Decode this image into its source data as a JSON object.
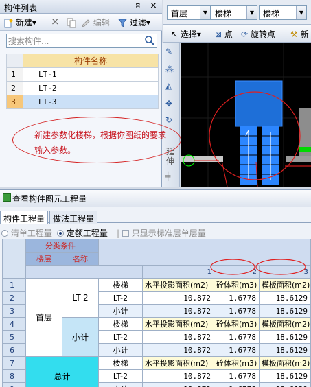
{
  "left_panel": {
    "title": "构件列表",
    "pin": "ʭ",
    "close": "×",
    "toolbar": {
      "new": "新建",
      "delete": "×",
      "edit": "编辑",
      "filter": "过滤"
    },
    "search": {
      "placeholder": "搜索构件..."
    },
    "table": {
      "header": "构件名称",
      "rows": [
        {
          "num": "1",
          "name": "LT-1"
        },
        {
          "num": "2",
          "name": "LT-2"
        },
        {
          "num": "3",
          "name": "LT-3"
        }
      ]
    },
    "vertical_toolbar": {
      "extend_label": "延伸"
    }
  },
  "right_panel": {
    "combos": [
      {
        "value": "首层"
      },
      {
        "value": "楼梯"
      },
      {
        "value": "楼梯"
      }
    ],
    "toolbar": {
      "select": "选择",
      "point": "点",
      "rotate_point": "旋转点",
      "new_more": "新"
    }
  },
  "annotation": {
    "line1": "新建参数化楼梯，根据你图纸的要求",
    "line2": "输入参数。"
  },
  "bottom_window": {
    "title": "查看构件图元工程量",
    "tabs": [
      "构件工程量",
      "做法工程量"
    ],
    "options": {
      "list_quantity": "清单工程量",
      "quota_quantity": "定额工程量",
      "show_standard_only": "只显示标准层单层量"
    },
    "grid": {
      "header_condition": "分类条件",
      "header_floor": "楼层",
      "header_name": "名称",
      "col_indexes": [
        "1",
        "2",
        "3"
      ],
      "floor_name": "首层",
      "component": "LT-2",
      "subtotal": "小计",
      "total": "总计",
      "row_numbers": [
        "1",
        "2",
        "3",
        "4",
        "5",
        "6",
        "7",
        "8",
        "9"
      ],
      "col_headers": [
        "水平投影面积(m2)",
        "砼体积(m3)",
        "模板面积(m2)"
      ],
      "item_header": "楼梯",
      "values": [
        "10.872",
        "1.6778",
        "18.6129"
      ]
    }
  }
}
